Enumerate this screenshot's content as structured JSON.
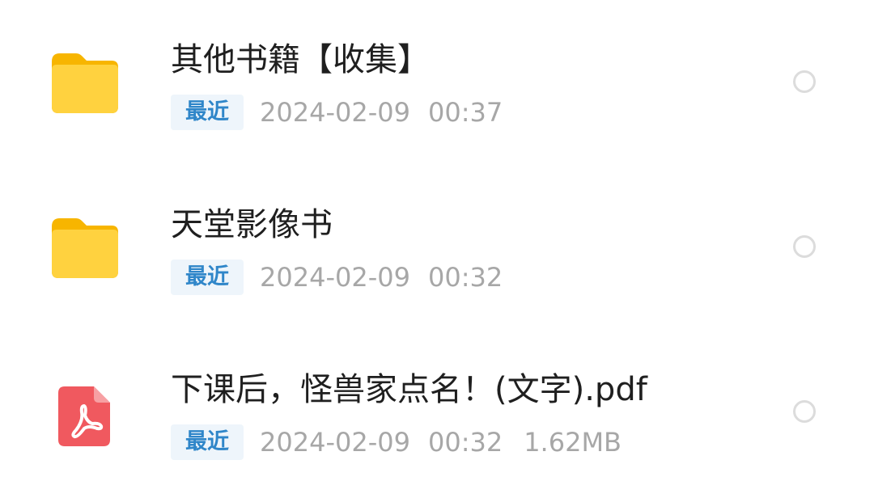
{
  "files": [
    {
      "type": "folder",
      "icon": "folder-icon",
      "name": "其他书籍【收集】",
      "badge": "最近",
      "date": "2024-02-09",
      "time": "00:37",
      "size": ""
    },
    {
      "type": "folder",
      "icon": "folder-icon",
      "name": "天堂影像书",
      "badge": "最近",
      "date": "2024-02-09",
      "time": "00:32",
      "size": ""
    },
    {
      "type": "pdf",
      "icon": "pdf-icon",
      "name": "下课后，怪兽家点名！(文字).pdf",
      "badge": "最近",
      "date": "2024-02-09",
      "time": "00:32",
      "size": "1.62MB"
    }
  ],
  "colors": {
    "folder": "#ffc72c",
    "pdf": "#f0595f",
    "badge_text": "#2f86c9",
    "badge_bg": "#eef5fb",
    "meta_text": "#a7a7a7",
    "title_text": "#1f1f1f",
    "radio_border": "#dcdcdc"
  }
}
